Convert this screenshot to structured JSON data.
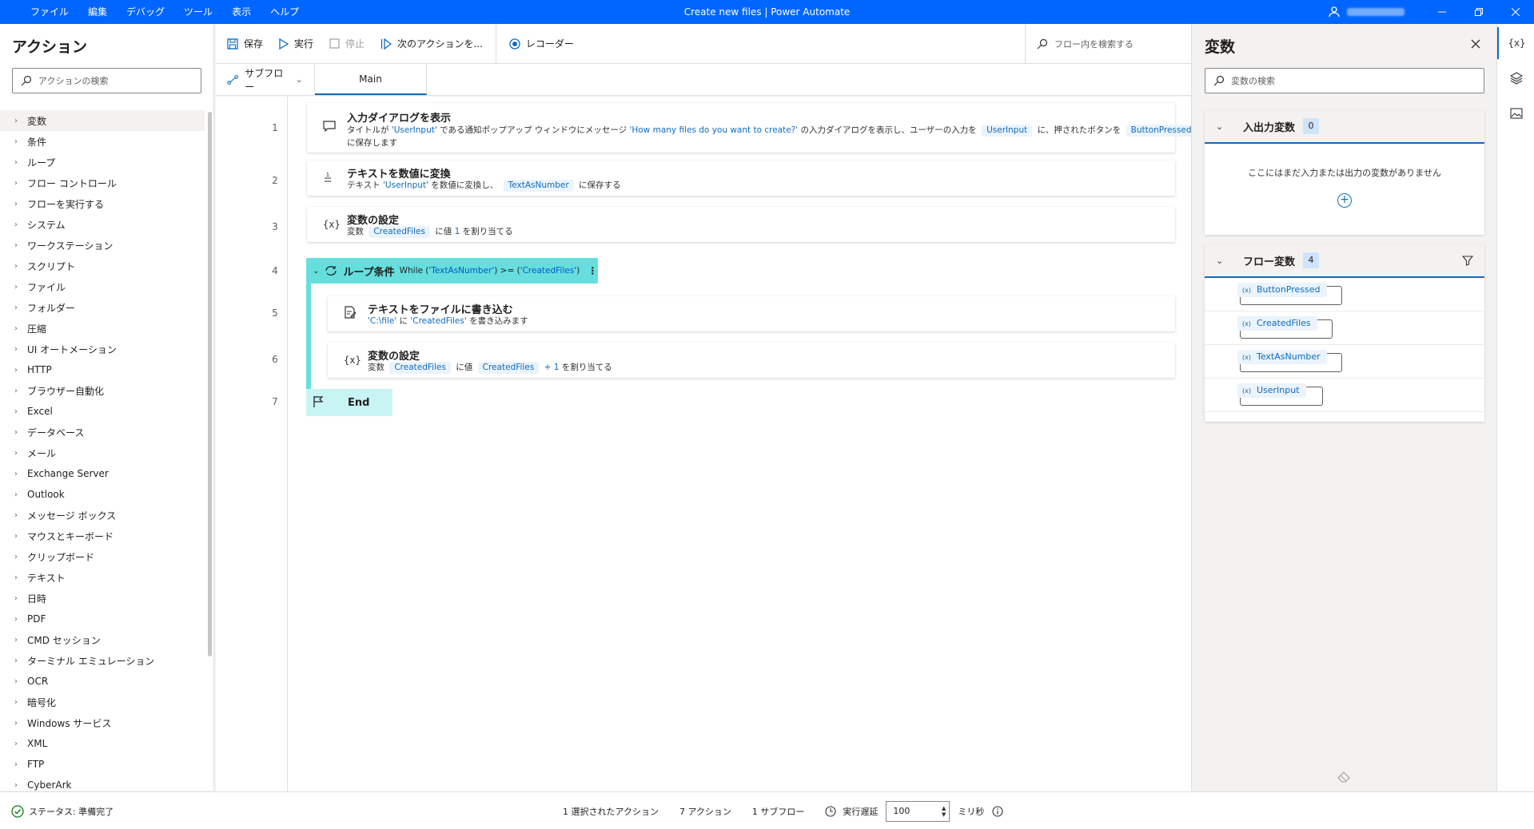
{
  "app": {
    "title": "Create new files | Power Automate",
    "menus": [
      "ファイル",
      "編集",
      "デバッグ",
      "ツール",
      "表示",
      "ヘルプ"
    ]
  },
  "actions_panel": {
    "title": "アクション",
    "search_placeholder": "アクションの検索",
    "items": [
      "変数",
      "条件",
      "ループ",
      "フロー コントロール",
      "フローを実行する",
      "システム",
      "ワークステーション",
      "スクリプト",
      "ファイル",
      "フォルダー",
      "圧縮",
      "UI オートメーション",
      "HTTP",
      "ブラウザー自動化",
      "Excel",
      "データベース",
      "メール",
      "Exchange Server",
      "Outlook",
      "メッセージ ボックス",
      "マウスとキーボード",
      "クリップボード",
      "テキスト",
      "日時",
      "PDF",
      "CMD セッション",
      "ターミナル エミュレーション",
      "OCR",
      "暗号化",
      "Windows サービス",
      "XML",
      "FTP",
      "CyberArk"
    ]
  },
  "toolbar": {
    "save": "保存",
    "run": "実行",
    "stop": "停止",
    "next_action": "次のアクションを...",
    "recorder": "レコーダー",
    "flow_search_placeholder": "フロー内を検索する"
  },
  "tabs": {
    "subflow": "サブフロー",
    "main": "Main"
  },
  "flow": {
    "line_numbers": [
      "1",
      "2",
      "3",
      "4",
      "5",
      "6",
      "7"
    ],
    "step1": {
      "title": "入力ダイアログを表示",
      "d1": "タイトルが",
      "v1": "'UserInput'",
      "d2": "である通知ポップアップ ウィンドウにメッセージ",
      "v2": "'How many files do you want to create?'",
      "d3": "の入力ダイアログを表示し、ユーザーの入力を",
      "chip1": "UserInput",
      "d4": "に、押されたボタンを",
      "chip2": "ButtonPressed",
      "d5": "に保存します"
    },
    "step2": {
      "title": "テキストを数値に変換",
      "d1": "テキスト",
      "v1": "'UserInput'",
      "d2": "を数値に変換し、",
      "chip1": "TextAsNumber",
      "d3": "に保存する"
    },
    "step3": {
      "title": "変数の設定",
      "d1": "変数",
      "chip1": "CreatedFiles",
      "d2": "に値",
      "v1": "1",
      "d3": "を割り当てる"
    },
    "loop": {
      "title": "ループ条件",
      "c1": "While (",
      "v1": "'TextAsNumber'",
      "c2": ") >= (",
      "v2": "'CreatedFiles'",
      "c3": ")"
    },
    "step5": {
      "title": "テキストをファイルに書き込む",
      "v1": "'C:\\file'",
      "d1": "に",
      "v2": "'CreatedFiles'",
      "d2": "を書き込みます"
    },
    "step6": {
      "title": "変数の設定",
      "d1": "変数",
      "chip1": "CreatedFiles",
      "d2": "に値",
      "chip2": "CreatedFiles",
      "v1": "+ 1",
      "d3": "を割り当てる"
    },
    "end": "End"
  },
  "variables": {
    "title": "変数",
    "search_placeholder": "変数の検索",
    "io_section": {
      "name": "入出力変数",
      "count": "0",
      "empty_message": "ここにはまだ入力または出力の変数がありません"
    },
    "flow_section": {
      "name": "フロー変数",
      "count": "4",
      "items": [
        "ButtonPressed",
        "CreatedFiles",
        "TextAsNumber",
        "UserInput"
      ]
    }
  },
  "side_strip": {
    "variables_icon_label": "{x}"
  },
  "statusbar": {
    "status": "ステータス: 準備完了",
    "selected": "1 選択されたアクション",
    "actions": "7 アクション",
    "subflows": "1 サブフロー",
    "delay_label": "実行遅延",
    "delay_value": "100",
    "delay_unit": "ミリ秒"
  },
  "colors": {
    "titlebar": "#0066ff",
    "accent": "#0f6cbd",
    "loop": "#66dede",
    "end": "#c9f4f4",
    "status_ok": "#107c10"
  }
}
